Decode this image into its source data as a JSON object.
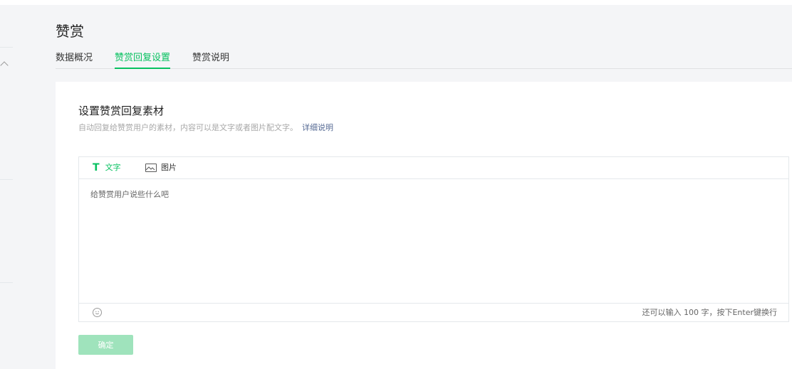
{
  "page": {
    "title": "赞赏"
  },
  "tabs": [
    {
      "label": "数据概况",
      "active": false
    },
    {
      "label": "赞赏回复设置",
      "active": true
    },
    {
      "label": "赞赏说明",
      "active": false
    }
  ],
  "card": {
    "title": "设置赞赏回复素材",
    "description": "自动回复给赞赏用户的素材，内容可以是文字或者图片配文字。",
    "detail_link": "详细说明"
  },
  "editor": {
    "tools": {
      "text_label": "文字",
      "text_icon": "text-T-icon",
      "image_label": "图片",
      "image_icon": "image-icon"
    },
    "placeholder": "给赞赏用户说些什么吧",
    "value": "",
    "emoji_icon": "smiley-icon",
    "counter_text": "还可以输入 100 字，按下Enter键换行"
  },
  "actions": {
    "confirm_label": "确定"
  },
  "colors": {
    "accent": "#07c160",
    "confirm_disabled": "#9fe3bc",
    "link": "#576b95",
    "page_bg": "#f4f5f7"
  }
}
